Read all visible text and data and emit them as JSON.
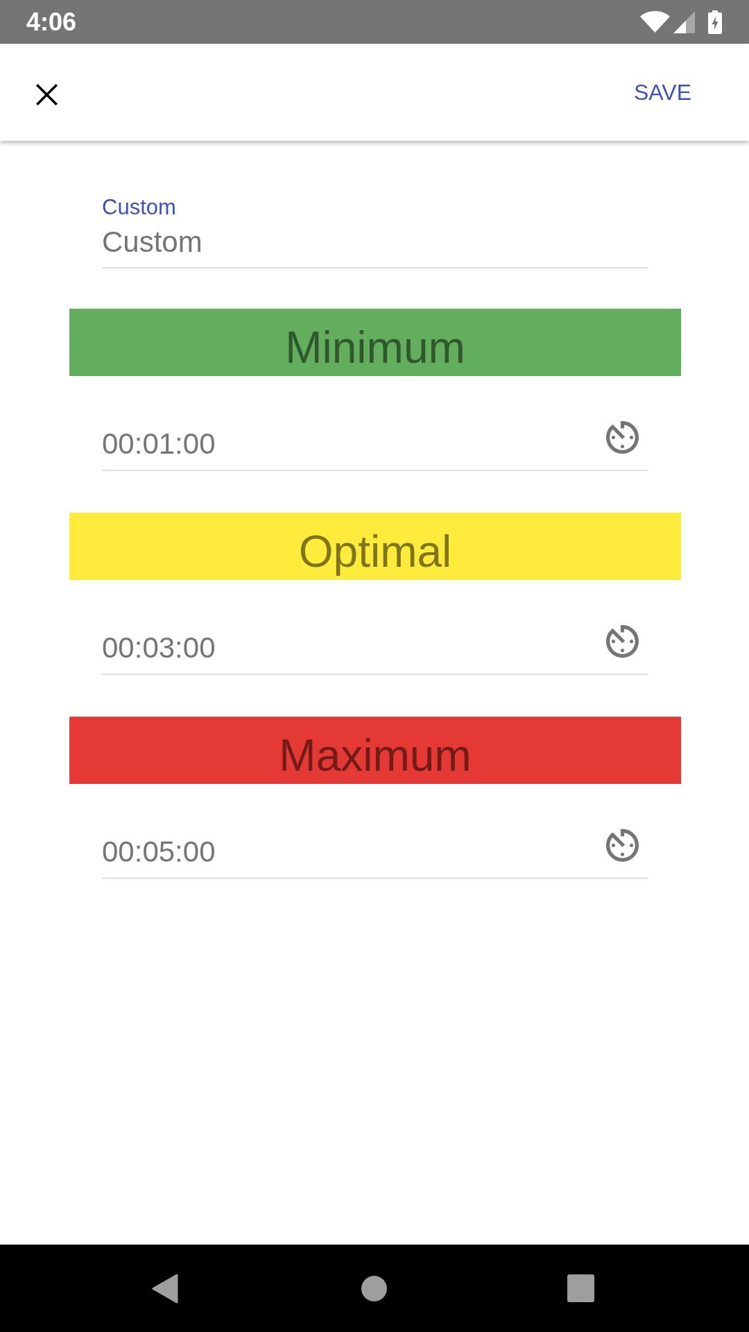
{
  "status_bar": {
    "time": "4:06"
  },
  "app_bar": {
    "action": "SAVE"
  },
  "name_field": {
    "label": "Custom",
    "value": "Custom"
  },
  "ranges": [
    {
      "label": "Minimum",
      "color": "#62ae5d",
      "value": "00:01:00"
    },
    {
      "label": "Optimal",
      "color": "#ffeb3b",
      "value": "00:03:00"
    },
    {
      "label": "Maximum",
      "color": "#e53935",
      "value": "00:05:00"
    }
  ]
}
